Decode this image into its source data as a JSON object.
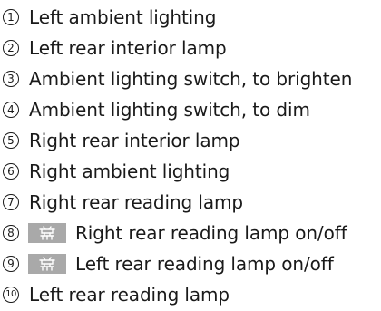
{
  "items": [
    {
      "num": "1",
      "label": "Left ambient lighting"
    },
    {
      "num": "2",
      "label": "Left rear interior lamp"
    },
    {
      "num": "3",
      "label": "Ambient lighting switch, to brighten"
    },
    {
      "num": "4",
      "label": "Ambient lighting switch, to dim"
    },
    {
      "num": "5",
      "label": "Right rear interior lamp"
    },
    {
      "num": "6",
      "label": "Right ambient lighting"
    },
    {
      "num": "7",
      "label": "Right rear reading lamp"
    },
    {
      "num": "8",
      "label": "Right rear reading lamp on/off",
      "icon": "reading-lamp-icon"
    },
    {
      "num": "9",
      "label": "Left rear reading lamp on/off",
      "icon": "reading-lamp-icon"
    },
    {
      "num": "10",
      "label": "Left rear reading lamp"
    }
  ],
  "colors": {
    "text": "#1a1a1a",
    "button_bg": "#a9a9a9",
    "icon": "#ffffff"
  }
}
